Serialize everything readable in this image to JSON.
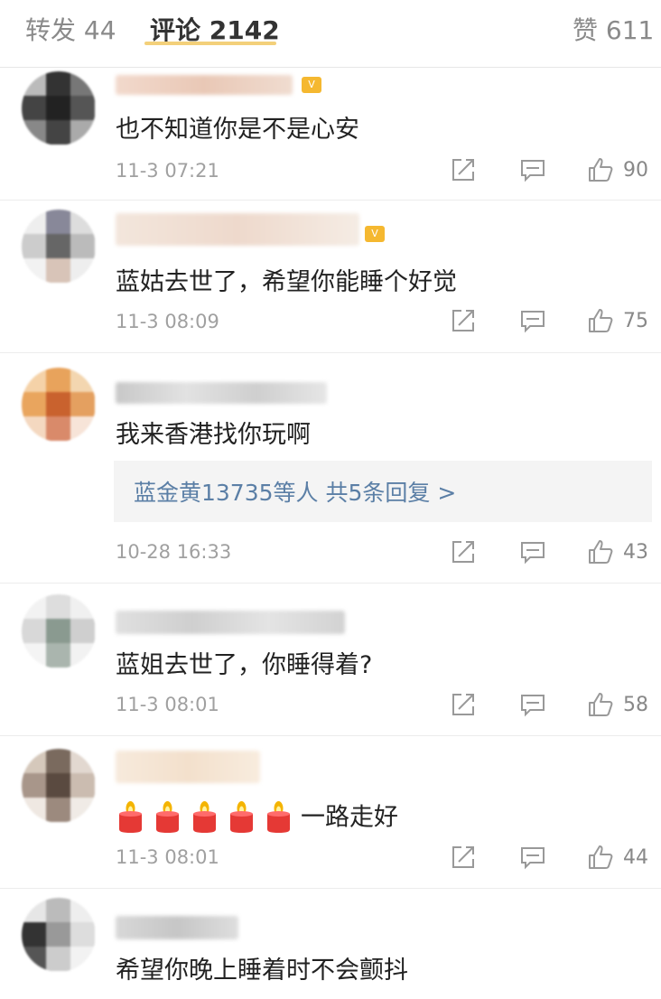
{
  "tabs": {
    "repost": {
      "label": "转发",
      "count": "44"
    },
    "comment": {
      "label": "评论",
      "count": "2142"
    },
    "like": {
      "label": "赞",
      "count": "611"
    }
  },
  "comments": [
    {
      "text": "也不知道你是不是心安",
      "time": "11-3 07:21",
      "likes": "90"
    },
    {
      "text": "蓝姑去世了，希望你能睡个好觉",
      "time": "11-3 08:09",
      "likes": "75"
    },
    {
      "text": "我来香港找你玩啊",
      "time": "10-28 16:33",
      "likes": "43",
      "reply_summary": "蓝金黄13735等人  共5条回复 >"
    },
    {
      "text": "蓝姐去世了，你睡得着?",
      "time": "11-3 08:01",
      "likes": "58"
    },
    {
      "text": "一路走好",
      "time": "11-3 08:01",
      "likes": "44",
      "emoji": "candle-icon",
      "emoji_count": 5
    },
    {
      "text": "希望你晚上睡着时不会颤抖"
    }
  ],
  "icons": {
    "repost": "share-icon",
    "reply": "comment-icon",
    "like": "thumbs-up-icon"
  },
  "colors": {
    "accent": "#f3d07a",
    "link": "#5b7fa6",
    "candle": "#e53935"
  }
}
